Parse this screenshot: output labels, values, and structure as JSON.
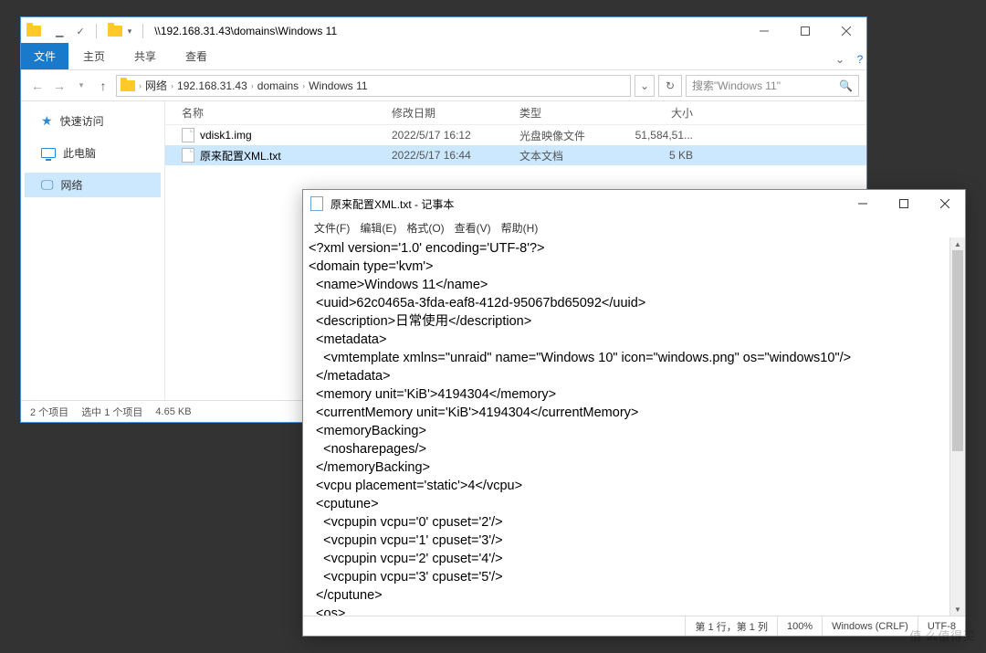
{
  "explorer": {
    "title_path": "\\\\192.168.31.43\\domains\\Windows 11",
    "ribbon": {
      "file": "文件",
      "home": "主页",
      "share": "共享",
      "view": "查看"
    },
    "nav": {
      "crumbs": [
        "网络",
        "192.168.31.43",
        "domains",
        "Windows 11"
      ],
      "search_placeholder": "搜索\"Windows 11\""
    },
    "sidebar": {
      "quick": "快速访问",
      "pc": "此电脑",
      "network": "网络"
    },
    "columns": {
      "name": "名称",
      "date": "修改日期",
      "type": "类型",
      "size": "大小"
    },
    "files": [
      {
        "name": "vdisk1.img",
        "date": "2022/5/17 16:12",
        "type": "光盘映像文件",
        "size": "51,584,51..."
      },
      {
        "name": "原来配置XML.txt",
        "date": "2022/5/17 16:44",
        "type": "文本文档",
        "size": "5 KB"
      }
    ],
    "status": {
      "count": "2 个项目",
      "selected": "选中 1 个项目",
      "size": "4.65 KB"
    }
  },
  "notepad": {
    "title": "原来配置XML.txt - 记事本",
    "menu": {
      "file": "文件(F)",
      "edit": "编辑(E)",
      "format": "格式(O)",
      "view": "查看(V)",
      "help": "帮助(H)"
    },
    "content": "<?xml version='1.0' encoding='UTF-8'?>\n<domain type='kvm'>\n  <name>Windows 11</name>\n  <uuid>62c0465a-3fda-eaf8-412d-95067bd65092</uuid>\n  <description>日常使用</description>\n  <metadata>\n    <vmtemplate xmlns=\"unraid\" name=\"Windows 10\" icon=\"windows.png\" os=\"windows10\"/>\n  </metadata>\n  <memory unit='KiB'>4194304</memory>\n  <currentMemory unit='KiB'>4194304</currentMemory>\n  <memoryBacking>\n    <nosharepages/>\n  </memoryBacking>\n  <vcpu placement='static'>4</vcpu>\n  <cputune>\n    <vcpupin vcpu='0' cpuset='2'/>\n    <vcpupin vcpu='1' cpuset='3'/>\n    <vcpupin vcpu='2' cpuset='4'/>\n    <vcpupin vcpu='3' cpuset='5'/>\n  </cputune>\n  <os>",
    "status": {
      "pos": "第 1 行，第 1 列",
      "zoom": "100%",
      "eol": "Windows (CRLF)",
      "enc": "UTF-8"
    }
  },
  "watermark": "值   么值得买"
}
